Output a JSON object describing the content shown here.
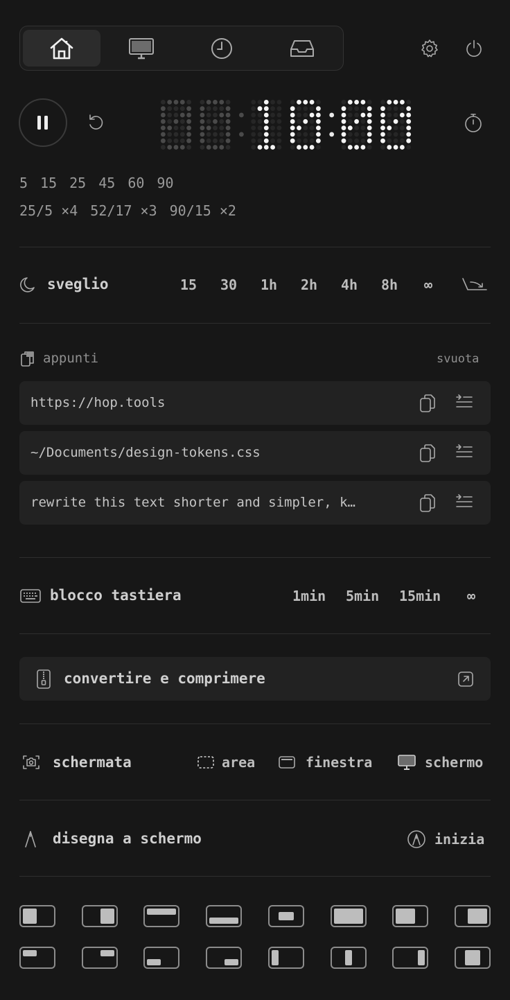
{
  "tabs": [
    {
      "icon": "home-icon",
      "active": true
    },
    {
      "icon": "monitor-icon",
      "active": false
    },
    {
      "icon": "clock-icon",
      "active": false
    },
    {
      "icon": "inbox-icon",
      "active": false
    }
  ],
  "timer": {
    "display": "00:10:00",
    "presets_minutes": [
      "5",
      "15",
      "25",
      "45",
      "60",
      "90"
    ],
    "presets_cycles": [
      "25/5 ×4",
      "52/17 ×3",
      "90/15 ×2"
    ]
  },
  "awake": {
    "label": "sveglio",
    "options": [
      "15",
      "30",
      "1h",
      "2h",
      "4h",
      "8h",
      "∞"
    ]
  },
  "clipboard": {
    "title": "appunti",
    "clear_label": "svuota",
    "items": [
      "https://hop.tools",
      "~/Documents/design-tokens.css",
      "rewrite this text shorter and simpler, k…"
    ]
  },
  "keyboard_lock": {
    "label": "blocco tastiera",
    "options": [
      "1min",
      "5min",
      "15min",
      "∞"
    ]
  },
  "convert": {
    "label": "convertire e comprimere"
  },
  "screenshot": {
    "label": "schermata",
    "area": "area",
    "window": "finestra",
    "screen": "schermo"
  },
  "draw": {
    "label": "disegna a schermo",
    "start": "inizia"
  },
  "window_layouts": [
    "left-half",
    "right-half",
    "top-half",
    "bottom-half",
    "center",
    "maximize",
    "left-two-thirds",
    "right-two-thirds",
    "top-left-quarter",
    "top-right-quarter",
    "bottom-left-quarter",
    "bottom-right-quarter",
    "left-third",
    "center-third",
    "right-third",
    "center-column"
  ],
  "colors": {
    "background": "#171717",
    "panel": "#222222",
    "text": "#d8d8d8",
    "muted": "#9a9a9a"
  }
}
